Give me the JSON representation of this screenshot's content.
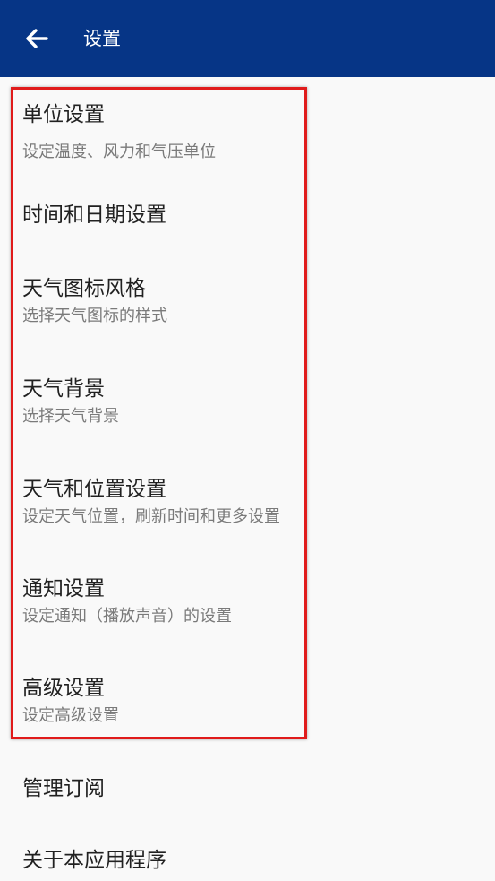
{
  "appbar": {
    "title": "设置",
    "back_icon": "arrow-left-icon",
    "background": "#063586"
  },
  "settings": [
    {
      "id": "units",
      "title": "单位设置",
      "subtitle": "设定温度、风力和气压单位"
    },
    {
      "id": "time-date",
      "title": "时间和日期设置",
      "subtitle": ""
    },
    {
      "id": "icon-style",
      "title": "天气图标风格",
      "subtitle": "选择天气图标的样式"
    },
    {
      "id": "background",
      "title": "天气背景",
      "subtitle": "选择天气背景"
    },
    {
      "id": "weather-location",
      "title": "天气和位置设置",
      "subtitle": "设定天气位置，刷新时间和更多设置"
    },
    {
      "id": "notification",
      "title": "通知设置",
      "subtitle": "设定通知（播放声音）的设置"
    },
    {
      "id": "advanced",
      "title": "高级设置",
      "subtitle": "设定高级设置"
    },
    {
      "id": "subscriptions",
      "title": "管理订阅",
      "subtitle": ""
    },
    {
      "id": "about",
      "title": "关于本应用程序",
      "subtitle": ""
    }
  ],
  "highlight_color": "#e01b1b"
}
